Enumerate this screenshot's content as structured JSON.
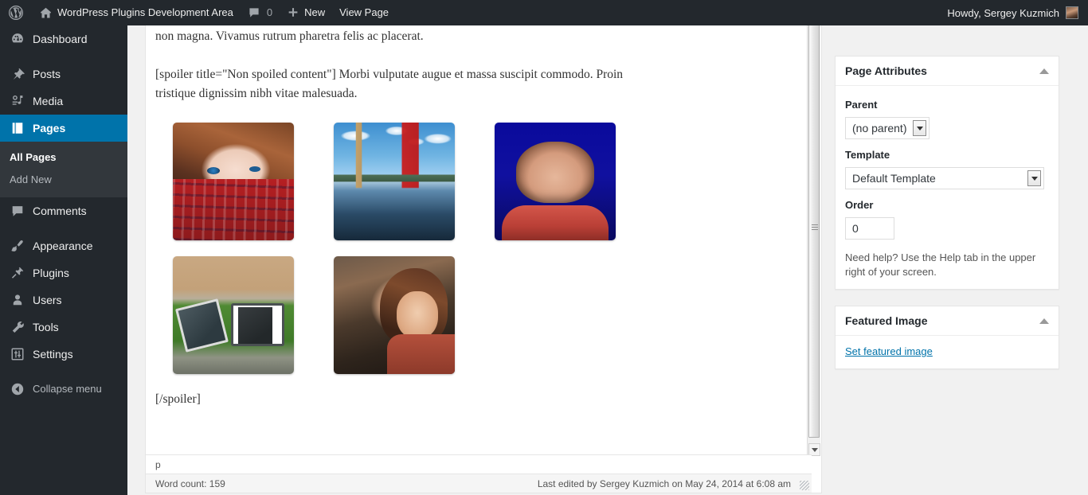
{
  "adminbar": {
    "wp_logo": "wordpress-logo-icon",
    "site_name": "WordPress Plugins Development Area",
    "home_icon": "home-icon",
    "comments_icon": "comment-bubble-icon",
    "comment_count": "0",
    "new_icon": "plus-icon",
    "new_label": "New",
    "view_page_label": "View Page",
    "howdy": "Howdy, Sergey Kuzmich",
    "avatar": "user-avatar"
  },
  "sidebar": {
    "items": [
      {
        "label": "Dashboard",
        "icon": "dashboard-icon",
        "current": false
      },
      {
        "label": "Posts",
        "icon": "pin-icon",
        "current": false
      },
      {
        "label": "Media",
        "icon": "media-icon",
        "current": false
      },
      {
        "label": "Pages",
        "icon": "pages-icon",
        "current": true
      },
      {
        "label": "Comments",
        "icon": "comment-bubble-icon",
        "current": false
      },
      {
        "label": "Appearance",
        "icon": "paintbrush-icon",
        "current": false
      },
      {
        "label": "Plugins",
        "icon": "plug-icon",
        "current": false
      },
      {
        "label": "Users",
        "icon": "user-icon",
        "current": false
      },
      {
        "label": "Tools",
        "icon": "wrench-icon",
        "current": false
      },
      {
        "label": "Settings",
        "icon": "sliders-icon",
        "current": false
      }
    ],
    "submenu": [
      {
        "label": "All Pages",
        "current": true
      },
      {
        "label": "Add New",
        "current": false
      }
    ],
    "collapse_label": "Collapse menu",
    "collapse_icon": "collapse-arrow-icon",
    "highlight_color": "#0073aa",
    "background_color": "#23282d"
  },
  "editor": {
    "paragraphs": [
      "amet lorem eleifend, ac scelerisque massa egestas. Nam nunc diam, pharetra a vestibulum ut, auctor non magna. Vivamus rutrum pharetra felis ac placerat.",
      "[spoiler title=\"Non spoiled content\"] Morbi vulputate augue et massa suscipit commodo. Proin tristique dignissim nibh vitae malesuada.",
      "[/spoiler]"
    ],
    "gallery": {
      "rows": [
        [
          {
            "name": "thumbnail-girl-plaid-shirt"
          },
          {
            "name": "thumbnail-big-ben-westminster-bridge"
          },
          {
            "name": "thumbnail-man-red-shirt-blue-background"
          }
        ],
        [
          {
            "name": "thumbnail-televisions-on-grass"
          },
          {
            "name": "thumbnail-girl-at-laptop"
          }
        ]
      ]
    },
    "path_indicator": "p",
    "word_count": "Word count: 159",
    "last_edited": "Last edited by Sergey Kuzmich on May 24, 2014 at 6:08 am"
  },
  "page_attributes": {
    "title": "Page Attributes",
    "toggle_icon": "toggle-collapse-icon",
    "parent_label": "Parent",
    "parent_value": "(no parent)",
    "template_label": "Template",
    "template_value": "Default Template",
    "order_label": "Order",
    "order_value": "0",
    "help_text": "Need help? Use the Help tab in the upper right of your screen."
  },
  "featured_image": {
    "title": "Featured Image",
    "toggle_icon": "toggle-collapse-icon",
    "link_label": "Set featured image"
  },
  "publish": {
    "button_color": "#2ea2cc"
  }
}
